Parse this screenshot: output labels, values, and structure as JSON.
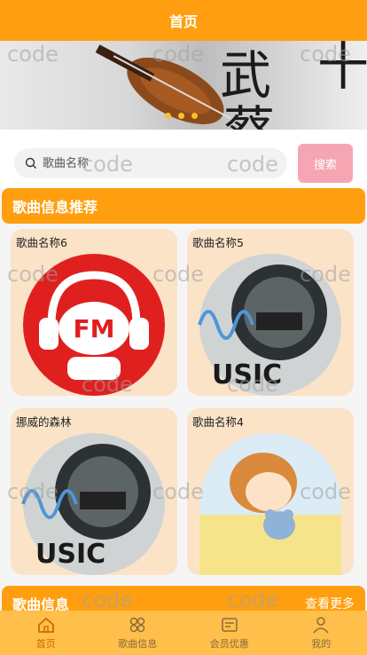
{
  "header": {
    "title": "首页"
  },
  "banner": {
    "text_chars": [
      "武",
      "蔡",
      "十"
    ],
    "dots": 3,
    "active_dot": 0
  },
  "search": {
    "placeholder": "歌曲名称",
    "button_label": "搜索"
  },
  "recommend": {
    "title": "歌曲信息推荐",
    "items": [
      {
        "title": "歌曲名称6",
        "art": "fm-headphones-icon"
      },
      {
        "title": "歌曲名称5",
        "art": "music-speaker-icon"
      },
      {
        "title": "挪威的森林",
        "art": "music-speaker-icon"
      },
      {
        "title": "歌曲名称4",
        "art": "sleeping-girl-icon"
      }
    ]
  },
  "song_info": {
    "title": "歌曲信息",
    "more_label": "查看更多"
  },
  "watermark": "code",
  "bottom_nav": {
    "items": [
      {
        "label": "首页",
        "icon": "home-icon",
        "active": true
      },
      {
        "label": "歌曲信息",
        "icon": "grid-icon",
        "active": false
      },
      {
        "label": "会员优惠",
        "icon": "card-icon",
        "active": false
      },
      {
        "label": "我的",
        "icon": "user-icon",
        "active": false
      }
    ]
  },
  "colors": {
    "primary": "#ff9f0f",
    "nav_bg": "#ffbf4a",
    "card_bg": "#fbe3c8",
    "search_btn": "#f6a6b3"
  }
}
